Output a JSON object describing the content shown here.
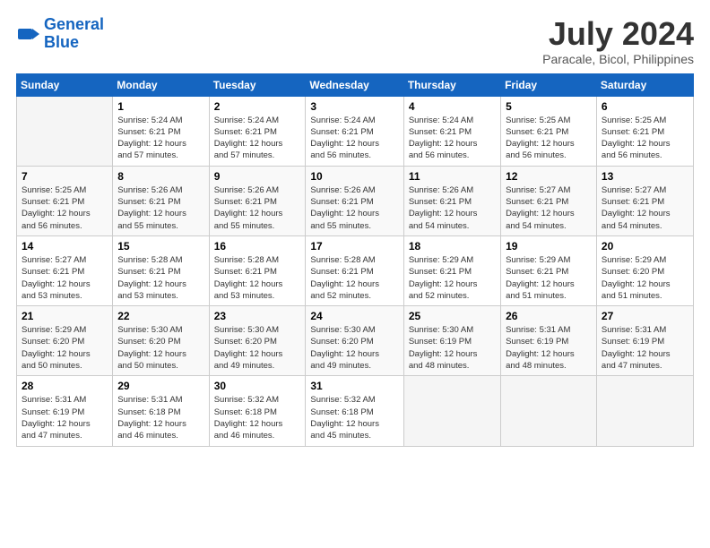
{
  "header": {
    "logo_line1": "General",
    "logo_line2": "Blue",
    "month_year": "July 2024",
    "location": "Paracale, Bicol, Philippines"
  },
  "days_of_week": [
    "Sunday",
    "Monday",
    "Tuesday",
    "Wednesday",
    "Thursday",
    "Friday",
    "Saturday"
  ],
  "weeks": [
    [
      {
        "day": "",
        "info": ""
      },
      {
        "day": "1",
        "info": "Sunrise: 5:24 AM\nSunset: 6:21 PM\nDaylight: 12 hours\nand 57 minutes."
      },
      {
        "day": "2",
        "info": "Sunrise: 5:24 AM\nSunset: 6:21 PM\nDaylight: 12 hours\nand 57 minutes."
      },
      {
        "day": "3",
        "info": "Sunrise: 5:24 AM\nSunset: 6:21 PM\nDaylight: 12 hours\nand 56 minutes."
      },
      {
        "day": "4",
        "info": "Sunrise: 5:24 AM\nSunset: 6:21 PM\nDaylight: 12 hours\nand 56 minutes."
      },
      {
        "day": "5",
        "info": "Sunrise: 5:25 AM\nSunset: 6:21 PM\nDaylight: 12 hours\nand 56 minutes."
      },
      {
        "day": "6",
        "info": "Sunrise: 5:25 AM\nSunset: 6:21 PM\nDaylight: 12 hours\nand 56 minutes."
      }
    ],
    [
      {
        "day": "7",
        "info": "Sunrise: 5:25 AM\nSunset: 6:21 PM\nDaylight: 12 hours\nand 56 minutes."
      },
      {
        "day": "8",
        "info": "Sunrise: 5:26 AM\nSunset: 6:21 PM\nDaylight: 12 hours\nand 55 minutes."
      },
      {
        "day": "9",
        "info": "Sunrise: 5:26 AM\nSunset: 6:21 PM\nDaylight: 12 hours\nand 55 minutes."
      },
      {
        "day": "10",
        "info": "Sunrise: 5:26 AM\nSunset: 6:21 PM\nDaylight: 12 hours\nand 55 minutes."
      },
      {
        "day": "11",
        "info": "Sunrise: 5:26 AM\nSunset: 6:21 PM\nDaylight: 12 hours\nand 54 minutes."
      },
      {
        "day": "12",
        "info": "Sunrise: 5:27 AM\nSunset: 6:21 PM\nDaylight: 12 hours\nand 54 minutes."
      },
      {
        "day": "13",
        "info": "Sunrise: 5:27 AM\nSunset: 6:21 PM\nDaylight: 12 hours\nand 54 minutes."
      }
    ],
    [
      {
        "day": "14",
        "info": "Sunrise: 5:27 AM\nSunset: 6:21 PM\nDaylight: 12 hours\nand 53 minutes."
      },
      {
        "day": "15",
        "info": "Sunrise: 5:28 AM\nSunset: 6:21 PM\nDaylight: 12 hours\nand 53 minutes."
      },
      {
        "day": "16",
        "info": "Sunrise: 5:28 AM\nSunset: 6:21 PM\nDaylight: 12 hours\nand 53 minutes."
      },
      {
        "day": "17",
        "info": "Sunrise: 5:28 AM\nSunset: 6:21 PM\nDaylight: 12 hours\nand 52 minutes."
      },
      {
        "day": "18",
        "info": "Sunrise: 5:29 AM\nSunset: 6:21 PM\nDaylight: 12 hours\nand 52 minutes."
      },
      {
        "day": "19",
        "info": "Sunrise: 5:29 AM\nSunset: 6:21 PM\nDaylight: 12 hours\nand 51 minutes."
      },
      {
        "day": "20",
        "info": "Sunrise: 5:29 AM\nSunset: 6:20 PM\nDaylight: 12 hours\nand 51 minutes."
      }
    ],
    [
      {
        "day": "21",
        "info": "Sunrise: 5:29 AM\nSunset: 6:20 PM\nDaylight: 12 hours\nand 50 minutes."
      },
      {
        "day": "22",
        "info": "Sunrise: 5:30 AM\nSunset: 6:20 PM\nDaylight: 12 hours\nand 50 minutes."
      },
      {
        "day": "23",
        "info": "Sunrise: 5:30 AM\nSunset: 6:20 PM\nDaylight: 12 hours\nand 49 minutes."
      },
      {
        "day": "24",
        "info": "Sunrise: 5:30 AM\nSunset: 6:20 PM\nDaylight: 12 hours\nand 49 minutes."
      },
      {
        "day": "25",
        "info": "Sunrise: 5:30 AM\nSunset: 6:19 PM\nDaylight: 12 hours\nand 48 minutes."
      },
      {
        "day": "26",
        "info": "Sunrise: 5:31 AM\nSunset: 6:19 PM\nDaylight: 12 hours\nand 48 minutes."
      },
      {
        "day": "27",
        "info": "Sunrise: 5:31 AM\nSunset: 6:19 PM\nDaylight: 12 hours\nand 47 minutes."
      }
    ],
    [
      {
        "day": "28",
        "info": "Sunrise: 5:31 AM\nSunset: 6:19 PM\nDaylight: 12 hours\nand 47 minutes."
      },
      {
        "day": "29",
        "info": "Sunrise: 5:31 AM\nSunset: 6:18 PM\nDaylight: 12 hours\nand 46 minutes."
      },
      {
        "day": "30",
        "info": "Sunrise: 5:32 AM\nSunset: 6:18 PM\nDaylight: 12 hours\nand 46 minutes."
      },
      {
        "day": "31",
        "info": "Sunrise: 5:32 AM\nSunset: 6:18 PM\nDaylight: 12 hours\nand 45 minutes."
      },
      {
        "day": "",
        "info": ""
      },
      {
        "day": "",
        "info": ""
      },
      {
        "day": "",
        "info": ""
      }
    ]
  ]
}
